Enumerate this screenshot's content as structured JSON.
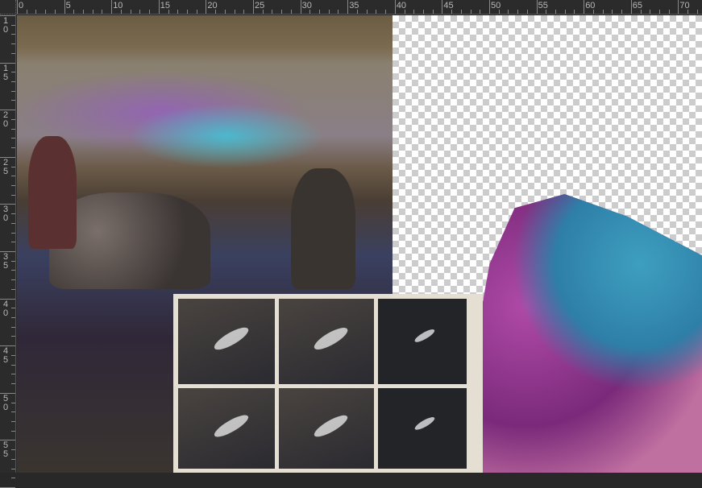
{
  "rulers": {
    "horizontal_labels": [
      "0",
      "5",
      "10",
      "15",
      "20",
      "25",
      "30",
      "35",
      "40",
      "45",
      "50",
      "55",
      "60",
      "65",
      "70"
    ],
    "vertical_labels": [
      "10",
      "15",
      "20",
      "25",
      "30",
      "35",
      "40",
      "45",
      "50",
      "55"
    ]
  },
  "canvas": {
    "layers": [
      "photo-pottery-scene",
      "contact-sheet",
      "crystal-cutout"
    ]
  }
}
